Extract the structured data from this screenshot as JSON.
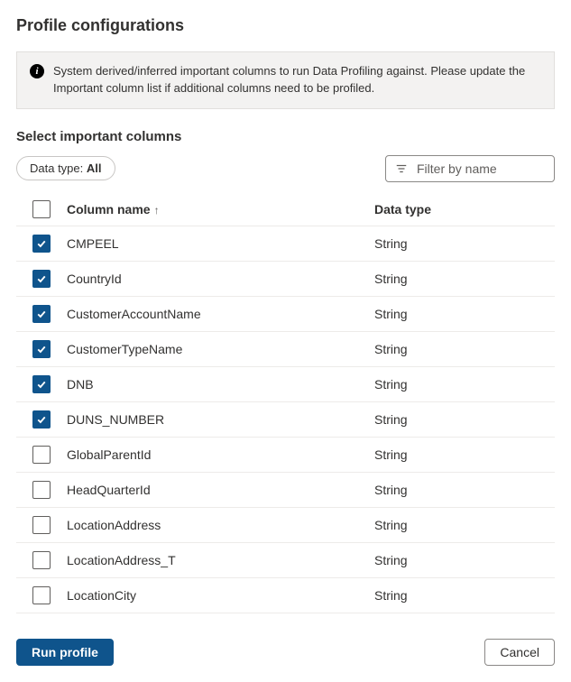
{
  "header": {
    "title": "Profile configurations"
  },
  "info": {
    "text": "System derived/inferred important columns to run Data Profiling against. Please update the Important column list if additional columns need to be profiled."
  },
  "section": {
    "title": "Select important columns"
  },
  "filter": {
    "pill_prefix": "Data type: ",
    "pill_value": "All",
    "name_placeholder": "Filter by name"
  },
  "table": {
    "header_all_checked": false,
    "col_name": "Column name",
    "col_type": "Data type",
    "sort_dir": "asc",
    "rows": [
      {
        "checked": true,
        "name": "CMPEEL",
        "type": "String"
      },
      {
        "checked": true,
        "name": "CountryId",
        "type": "String"
      },
      {
        "checked": true,
        "name": "CustomerAccountName",
        "type": "String"
      },
      {
        "checked": true,
        "name": "CustomerTypeName",
        "type": "String"
      },
      {
        "checked": true,
        "name": "DNB",
        "type": "String"
      },
      {
        "checked": true,
        "name": "DUNS_NUMBER",
        "type": "String"
      },
      {
        "checked": false,
        "name": "GlobalParentId",
        "type": "String"
      },
      {
        "checked": false,
        "name": "HeadQuarterId",
        "type": "String"
      },
      {
        "checked": false,
        "name": "LocationAddress",
        "type": "String"
      },
      {
        "checked": false,
        "name": "LocationAddress_T",
        "type": "String"
      },
      {
        "checked": false,
        "name": "LocationCity",
        "type": "String"
      }
    ]
  },
  "footer": {
    "run_label": "Run profile",
    "cancel_label": "Cancel"
  }
}
